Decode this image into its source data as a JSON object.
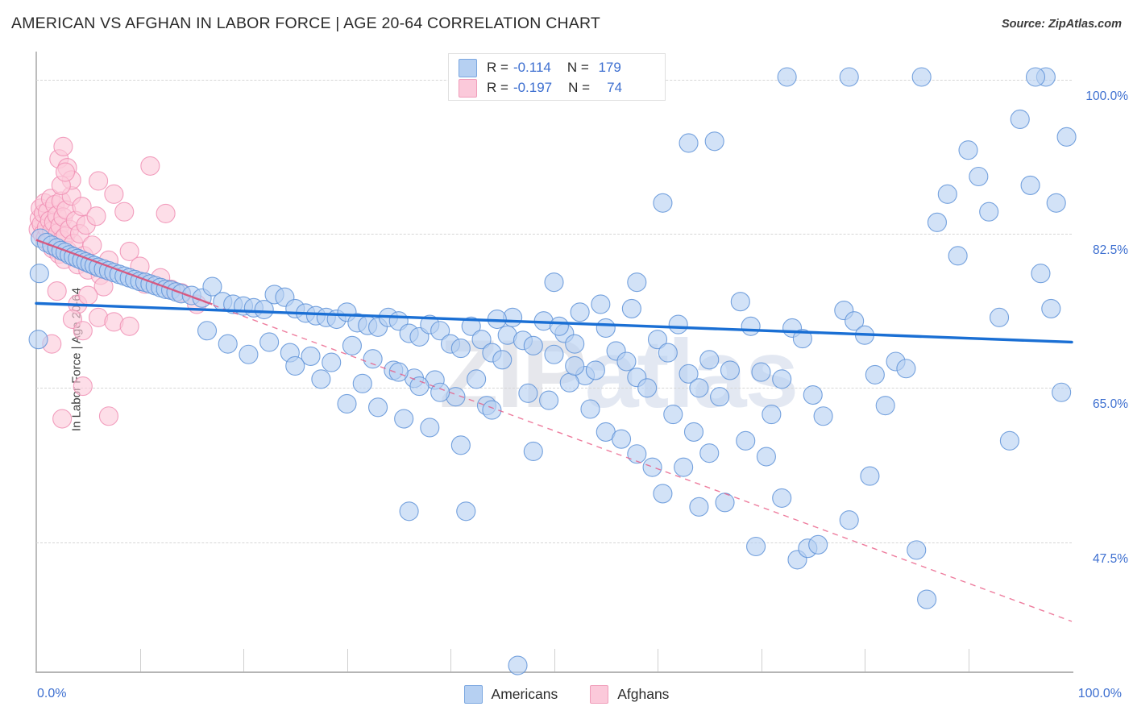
{
  "header": {
    "title": "AMERICAN VS AFGHAN IN LABOR FORCE | AGE 20-64 CORRELATION CHART",
    "source": "Source: ZipAtlas.com"
  },
  "axes": {
    "ylabel": "In Labor Force | Age 20-64",
    "y_ticks": [
      "100.0%",
      "82.5%",
      "65.0%",
      "47.5%"
    ],
    "x_min_label": "0.0%",
    "x_max_label": "100.0%"
  },
  "watermark": {
    "left": "ZIP",
    "right": "atlas"
  },
  "legend": {
    "rows": [
      {
        "series": "Americans",
        "r_label": "R =",
        "r_value": "-0.114",
        "n_label": "N =",
        "n_value": "179",
        "color": "#b6d0f2"
      },
      {
        "series": "Afghans",
        "r_label": "R =",
        "r_value": "-0.197",
        "n_label": "N =",
        "n_value": "74",
        "color": "#fbc9da"
      }
    ]
  },
  "bottom_legend": [
    {
      "label": "Americans",
      "color": "#b6d0f2"
    },
    {
      "label": "Afghans",
      "color": "#fbc9da"
    }
  ],
  "colors": {
    "blue_fill": "#b6d0f2",
    "blue_stroke": "#5f93d8",
    "pink_fill": "#fbc9da",
    "pink_stroke": "#f08fb4",
    "blue_line": "#1a6fd4",
    "pink_line": "#e8527e",
    "tick_text": "#3d6fd0",
    "grid": "#d6d6d6"
  },
  "chart_data": {
    "type": "scatter",
    "title": "AMERICAN VS AFGHAN IN LABOR FORCE | AGE 20-64 CORRELATION CHART",
    "xlabel": "",
    "ylabel": "In Labor Force | Age 20-64",
    "xlim": [
      0,
      100
    ],
    "ylim": [
      33.0,
      103.0
    ],
    "x_ticks": [
      0,
      100
    ],
    "y_ticks": [
      47.5,
      65.0,
      82.5,
      100.0
    ],
    "grid": true,
    "legend_position": "top-center",
    "series": [
      {
        "name": "Americans",
        "color": "#b6d0f2",
        "R": -0.114,
        "N": 179,
        "trend": {
          "type": "solid",
          "color": "#1a6fd4",
          "x0": 0,
          "y0": 74.6,
          "x1": 100,
          "y1": 70.2
        },
        "points": [
          [
            0.2,
            70.5
          ],
          [
            0.4,
            82.0
          ],
          [
            1.0,
            81.5
          ],
          [
            1.5,
            81.2
          ],
          [
            2.0,
            80.9
          ],
          [
            2.4,
            80.6
          ],
          [
            2.8,
            80.4
          ],
          [
            3.2,
            80.1
          ],
          [
            3.6,
            79.9
          ],
          [
            4.0,
            79.7
          ],
          [
            4.4,
            79.5
          ],
          [
            4.8,
            79.3
          ],
          [
            5.2,
            79.1
          ],
          [
            5.6,
            78.9
          ],
          [
            6.0,
            78.7
          ],
          [
            6.5,
            78.5
          ],
          [
            7.0,
            78.3
          ],
          [
            7.5,
            78.1
          ],
          [
            8.0,
            77.9
          ],
          [
            8.5,
            77.7
          ],
          [
            9.0,
            77.5
          ],
          [
            9.5,
            77.3
          ],
          [
            10.0,
            77.1
          ],
          [
            10.5,
            77.0
          ],
          [
            11.0,
            76.8
          ],
          [
            11.5,
            76.6
          ],
          [
            12.0,
            76.4
          ],
          [
            12.5,
            76.2
          ],
          [
            13.0,
            76.1
          ],
          [
            13.5,
            75.9
          ],
          [
            14.0,
            75.7
          ],
          [
            15.0,
            75.5
          ],
          [
            16.0,
            75.2
          ],
          [
            17.0,
            76.5
          ],
          [
            18.0,
            74.8
          ],
          [
            19.0,
            74.5
          ],
          [
            20.0,
            74.3
          ],
          [
            21.0,
            74.1
          ],
          [
            22.0,
            73.9
          ],
          [
            23.0,
            75.6
          ],
          [
            24.0,
            75.3
          ],
          [
            25.0,
            74.0
          ],
          [
            26.0,
            73.5
          ],
          [
            27.0,
            73.2
          ],
          [
            28.0,
            73.0
          ],
          [
            29.0,
            72.8
          ],
          [
            30.0,
            73.6
          ],
          [
            31.0,
            72.4
          ],
          [
            32.0,
            72.1
          ],
          [
            33.0,
            71.9
          ],
          [
            34.0,
            73.0
          ],
          [
            35.0,
            72.6
          ],
          [
            36.0,
            71.2
          ],
          [
            37.0,
            70.8
          ],
          [
            38.0,
            72.2
          ],
          [
            39.0,
            71.5
          ],
          [
            40.0,
            70.0
          ],
          [
            41.0,
            69.5
          ],
          [
            42.0,
            72.0
          ],
          [
            43.0,
            70.5
          ],
          [
            44.0,
            69.0
          ],
          [
            45.0,
            68.2
          ],
          [
            22.5,
            70.2
          ],
          [
            24.5,
            69.0
          ],
          [
            26.5,
            68.6
          ],
          [
            28.5,
            67.9
          ],
          [
            30.5,
            69.8
          ],
          [
            32.5,
            68.3
          ],
          [
            34.5,
            67.0
          ],
          [
            36.5,
            66.1
          ],
          [
            38.5,
            65.9
          ],
          [
            40.5,
            64.0
          ],
          [
            41.5,
            51.0
          ],
          [
            43.5,
            63.0
          ],
          [
            30.0,
            63.2
          ],
          [
            33.0,
            62.8
          ],
          [
            35.0,
            66.8
          ],
          [
            37.0,
            65.2
          ],
          [
            39.0,
            64.5
          ],
          [
            45.5,
            71.0
          ],
          [
            47.0,
            70.4
          ],
          [
            48.0,
            69.8
          ],
          [
            49.0,
            72.6
          ],
          [
            50.0,
            68.8
          ],
          [
            51.0,
            71.2
          ],
          [
            52.0,
            70.0
          ],
          [
            53.0,
            66.4
          ],
          [
            54.0,
            67.0
          ],
          [
            55.0,
            71.8
          ],
          [
            56.0,
            69.2
          ],
          [
            57.0,
            68.0
          ],
          [
            58.0,
            66.2
          ],
          [
            59.0,
            65.0
          ],
          [
            47.5,
            64.4
          ],
          [
            49.5,
            63.6
          ],
          [
            51.5,
            65.6
          ],
          [
            53.5,
            62.6
          ],
          [
            55.0,
            60.0
          ],
          [
            56.5,
            59.2
          ],
          [
            58.0,
            57.5
          ],
          [
            59.5,
            56.0
          ],
          [
            48.0,
            57.8
          ],
          [
            50.0,
            77.0
          ],
          [
            52.0,
            67.5
          ],
          [
            46.0,
            73.0
          ],
          [
            44.5,
            72.8
          ],
          [
            42.5,
            66.0
          ],
          [
            60.0,
            70.5
          ],
          [
            61.0,
            69.0
          ],
          [
            62.0,
            72.2
          ],
          [
            63.0,
            66.6
          ],
          [
            64.0,
            65.0
          ],
          [
            65.0,
            68.2
          ],
          [
            66.0,
            64.0
          ],
          [
            67.0,
            67.0
          ],
          [
            61.5,
            62.0
          ],
          [
            63.5,
            60.0
          ],
          [
            65.0,
            57.6
          ],
          [
            66.5,
            52.0
          ],
          [
            62.5,
            56.0
          ],
          [
            60.5,
            53.0
          ],
          [
            64.0,
            51.5
          ],
          [
            68.0,
            74.8
          ],
          [
            69.0,
            72.0
          ],
          [
            70.0,
            66.8
          ],
          [
            71.0,
            62.0
          ],
          [
            72.0,
            66.0
          ],
          [
            73.0,
            71.8
          ],
          [
            74.0,
            70.6
          ],
          [
            75.0,
            64.2
          ],
          [
            76.0,
            61.8
          ],
          [
            68.5,
            59.0
          ],
          [
            70.5,
            57.2
          ],
          [
            72.0,
            52.5
          ],
          [
            69.5,
            47.0
          ],
          [
            73.5,
            45.5
          ],
          [
            74.5,
            46.8
          ],
          [
            75.5,
            47.2
          ],
          [
            78.0,
            73.8
          ],
          [
            79.0,
            72.6
          ],
          [
            80.0,
            71.0
          ],
          [
            81.0,
            66.5
          ],
          [
            82.0,
            63.0
          ],
          [
            80.5,
            55.0
          ],
          [
            78.5,
            50.0
          ],
          [
            83.0,
            68.0
          ],
          [
            84.0,
            67.2
          ],
          [
            85.0,
            46.6
          ],
          [
            86.0,
            41.0
          ],
          [
            87.0,
            83.8
          ],
          [
            88.0,
            87.0
          ],
          [
            89.0,
            80.0
          ],
          [
            90.0,
            92.0
          ],
          [
            91.0,
            89.0
          ],
          [
            92.0,
            85.0
          ],
          [
            93.0,
            73.0
          ],
          [
            94.0,
            59.0
          ],
          [
            95.0,
            95.5
          ],
          [
            96.0,
            88.0
          ],
          [
            97.0,
            78.0
          ],
          [
            98.0,
            74.0
          ],
          [
            99.0,
            64.5
          ],
          [
            99.5,
            93.5
          ],
          [
            98.5,
            86.0
          ],
          [
            97.5,
            100.3
          ],
          [
            96.5,
            100.3
          ],
          [
            85.5,
            100.3
          ],
          [
            78.5,
            100.3
          ],
          [
            72.5,
            100.3
          ],
          [
            65.5,
            93.0
          ],
          [
            63.0,
            92.8
          ],
          [
            60.5,
            86.0
          ],
          [
            58.0,
            77.0
          ],
          [
            57.5,
            74.0
          ],
          [
            54.5,
            74.5
          ],
          [
            52.5,
            73.6
          ],
          [
            50.5,
            72.0
          ],
          [
            46.5,
            33.5
          ],
          [
            36.0,
            51.0
          ],
          [
            44.0,
            62.5
          ],
          [
            41.0,
            58.5
          ],
          [
            38.0,
            60.5
          ],
          [
            35.5,
            61.5
          ],
          [
            31.5,
            65.5
          ],
          [
            27.5,
            66.0
          ],
          [
            25.0,
            67.5
          ],
          [
            20.5,
            68.8
          ],
          [
            18.5,
            70.0
          ],
          [
            16.5,
            71.5
          ],
          [
            0.3,
            78.0
          ]
        ]
      },
      {
        "name": "Afghans",
        "color": "#fbc9da",
        "R": -0.197,
        "N": 74,
        "trend": {
          "type": "dashed",
          "color": "#e8527e",
          "x0": 0,
          "y0": 81.8,
          "x1": 100,
          "y1": 38.5
        },
        "points": [
          [
            0.2,
            83.0
          ],
          [
            0.3,
            84.2
          ],
          [
            0.4,
            85.4
          ],
          [
            0.5,
            83.6
          ],
          [
            0.6,
            82.4
          ],
          [
            0.7,
            84.8
          ],
          [
            0.8,
            86.0
          ],
          [
            0.9,
            82.0
          ],
          [
            1.0,
            83.2
          ],
          [
            1.1,
            85.0
          ],
          [
            1.2,
            81.5
          ],
          [
            1.3,
            84.0
          ],
          [
            1.4,
            86.5
          ],
          [
            1.5,
            82.8
          ],
          [
            1.6,
            80.8
          ],
          [
            1.7,
            83.8
          ],
          [
            1.8,
            85.8
          ],
          [
            1.9,
            81.0
          ],
          [
            2.0,
            84.6
          ],
          [
            2.1,
            82.6
          ],
          [
            2.2,
            80.2
          ],
          [
            2.3,
            83.4
          ],
          [
            2.4,
            86.2
          ],
          [
            2.5,
            81.8
          ],
          [
            2.6,
            84.4
          ],
          [
            2.7,
            79.6
          ],
          [
            2.8,
            82.2
          ],
          [
            2.9,
            85.2
          ],
          [
            3.0,
            80.6
          ],
          [
            3.2,
            83.0
          ],
          [
            3.4,
            86.8
          ],
          [
            3.6,
            81.4
          ],
          [
            3.8,
            84.0
          ],
          [
            4.0,
            79.0
          ],
          [
            4.2,
            82.5
          ],
          [
            4.4,
            85.6
          ],
          [
            4.6,
            80.0
          ],
          [
            4.8,
            83.5
          ],
          [
            5.0,
            78.4
          ],
          [
            5.4,
            81.2
          ],
          [
            5.8,
            84.5
          ],
          [
            6.2,
            77.8
          ],
          [
            2.2,
            91.0
          ],
          [
            2.6,
            92.4
          ],
          [
            3.0,
            90.0
          ],
          [
            3.4,
            88.6
          ],
          [
            2.4,
            88.0
          ],
          [
            2.8,
            89.5
          ],
          [
            6.0,
            88.5
          ],
          [
            11.0,
            90.2
          ],
          [
            12.5,
            84.8
          ],
          [
            7.5,
            87.0
          ],
          [
            8.5,
            85.0
          ],
          [
            6.5,
            76.5
          ],
          [
            7.0,
            79.5
          ],
          [
            9.0,
            80.5
          ],
          [
            10.0,
            78.8
          ],
          [
            4.0,
            74.5
          ],
          [
            5.0,
            75.5
          ],
          [
            3.5,
            72.8
          ],
          [
            2.0,
            76.0
          ],
          [
            6.0,
            73.0
          ],
          [
            7.5,
            72.5
          ],
          [
            4.5,
            71.5
          ],
          [
            1.5,
            70.0
          ],
          [
            9.0,
            72.0
          ],
          [
            4.5,
            65.2
          ],
          [
            2.5,
            61.5
          ],
          [
            7.0,
            61.8
          ],
          [
            12.0,
            77.5
          ],
          [
            14.0,
            75.8
          ],
          [
            15.5,
            74.5
          ],
          [
            10.5,
            76.8
          ],
          [
            13.0,
            76.2
          ]
        ]
      }
    ]
  }
}
